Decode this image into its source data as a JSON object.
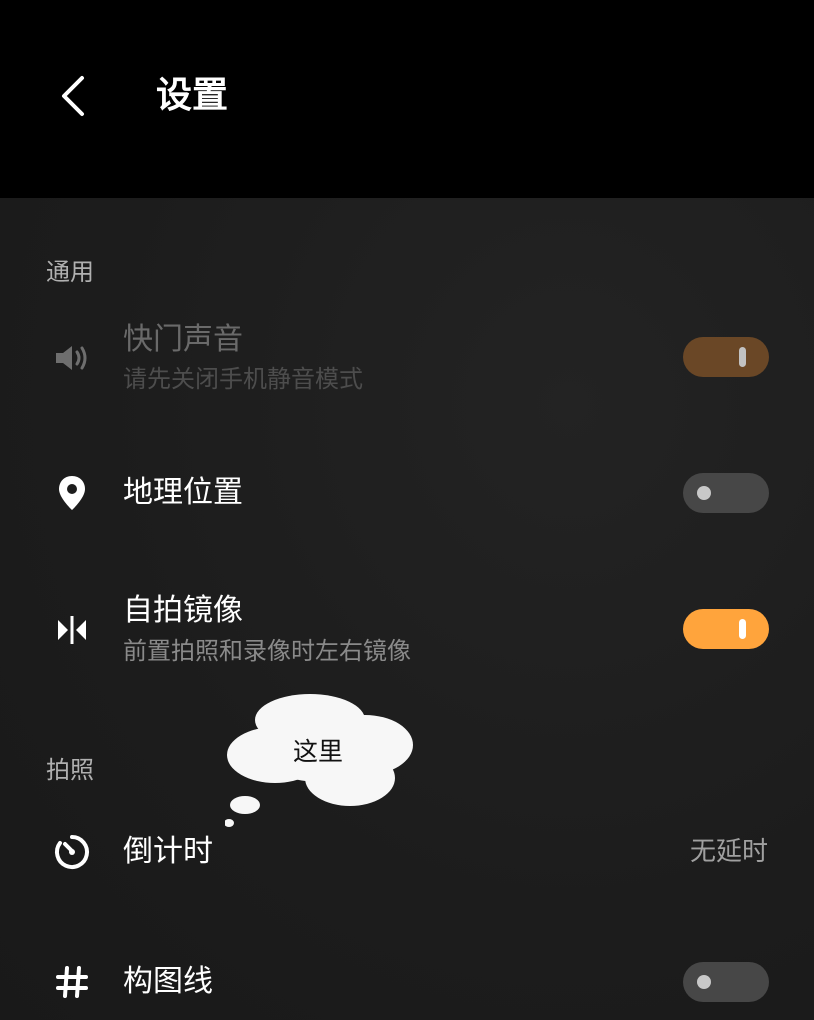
{
  "header": {
    "title": "设置",
    "back_icon": "chevron-left-icon"
  },
  "sections": [
    {
      "title": "通用"
    },
    {
      "title": "拍照"
    }
  ],
  "rows": {
    "shutter_sound": {
      "label": "快门声音",
      "sub": "请先关闭手机静音模式",
      "icon": "speaker-icon",
      "toggle": "on",
      "enabled": false
    },
    "location": {
      "label": "地理位置",
      "icon": "location-pin-icon",
      "toggle": "off"
    },
    "selfie_mirror": {
      "label": "自拍镜像",
      "sub": "前置拍照和录像时左右镜像",
      "icon": "mirror-icon",
      "toggle": "on"
    },
    "countdown": {
      "label": "倒计时",
      "value": "无延时",
      "icon": "timer-icon"
    },
    "grid_lines": {
      "label": "构图线",
      "icon": "grid-hash-icon",
      "toggle": "off"
    }
  },
  "annotation": {
    "text": "这里"
  },
  "colors": {
    "accent": "#ffa43c",
    "accent_dim": "#6a4726",
    "toggle_off": "#474747",
    "header_bg": "#000000"
  }
}
